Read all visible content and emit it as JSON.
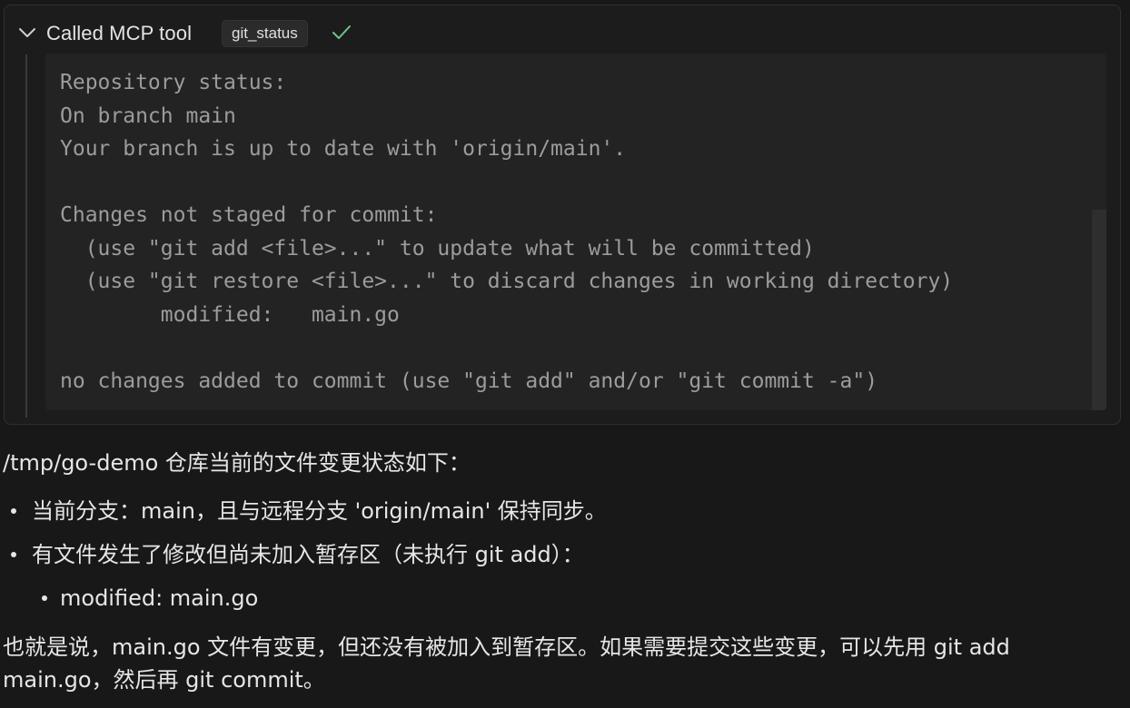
{
  "tool_card": {
    "title": "Called MCP tool",
    "tool_name": "git_status",
    "status_icon": "checkmark-icon",
    "expand_icon": "chevron-down-icon",
    "colors": {
      "check": "#6fc28b"
    },
    "output_lines": [
      "Repository status:",
      "On branch main",
      "Your branch is up to date with 'origin/main'.",
      "",
      "Changes not staged for commit:",
      "  (use \"git add <file>...\" to update what will be committed)",
      "  (use \"git restore <file>...\" to discard changes in working directory)",
      "        modified:   main.go",
      "",
      "no changes added to commit (use \"git add\" and/or \"git commit -a\")"
    ]
  },
  "summary": {
    "intro": "/tmp/go-demo 仓库当前的文件变更状态如下：",
    "bullets": [
      "当前分支：main，且与远程分支 'origin/main' 保持同步。",
      "有文件发生了修改但尚未加入暂存区（未执行 git add）："
    ],
    "sub_bullets": [
      "modified: main.go"
    ],
    "outro": "也就是说，main.go 文件有变更，但还没有被加入到暂存区。如果需要提交这些变更，可以先用 git add main.go，然后再 git commit。"
  }
}
